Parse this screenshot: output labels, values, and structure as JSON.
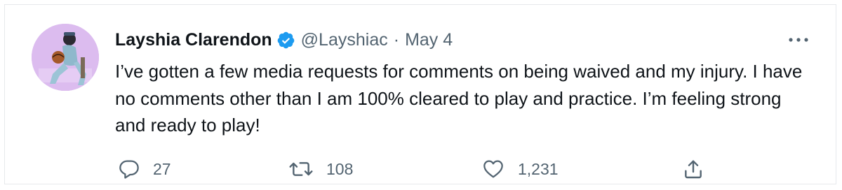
{
  "tweet": {
    "author": {
      "name": "Layshia Clarendon",
      "handle": "@Layshiac",
      "verified": true,
      "verified_color": "#1d9bf0"
    },
    "separator": "·",
    "date": "May 4",
    "text": "I’ve gotten a few media requests for comments on being waived and my injury. I have no comments other than I am 100% cleared to play and practice. I’m feeling strong and ready to play!",
    "stats": {
      "replies": "27",
      "retweets": "108",
      "likes": "1,231"
    },
    "icons": {
      "more": "more-dots-icon",
      "reply": "reply-bubble-icon",
      "retweet": "retweet-arrows-icon",
      "like": "heart-icon",
      "share": "share-upload-icon"
    },
    "colors": {
      "text": "#0f1419",
      "secondary": "#536471",
      "verified": "#1d9bf0",
      "avatar_bg": "#d6b4ec"
    }
  }
}
